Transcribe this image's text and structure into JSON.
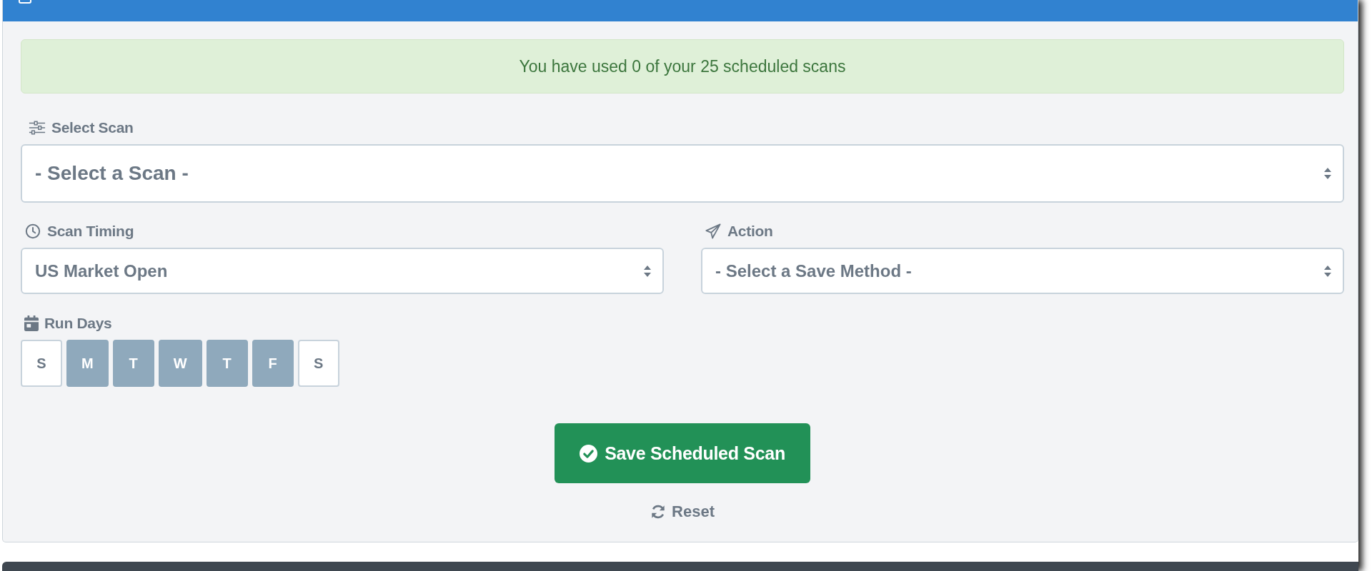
{
  "alert": {
    "text": "You have used 0 of your 25 scheduled scans"
  },
  "select_scan": {
    "label": "Select Scan",
    "value": "- Select a Scan -"
  },
  "scan_timing": {
    "label": "Scan Timing",
    "value": "US Market Open"
  },
  "action": {
    "label": "Action",
    "value": "- Select a Save Method -"
  },
  "run_days": {
    "label": "Run Days",
    "days": [
      {
        "label": "S",
        "selected": false
      },
      {
        "label": "M",
        "selected": true
      },
      {
        "label": "T",
        "selected": true
      },
      {
        "label": "W",
        "selected": true
      },
      {
        "label": "T",
        "selected": true
      },
      {
        "label": "F",
        "selected": true
      },
      {
        "label": "S",
        "selected": false
      }
    ]
  },
  "save_button": {
    "label": "Save Scheduled Scan"
  },
  "reset_link": {
    "label": "Reset"
  }
}
